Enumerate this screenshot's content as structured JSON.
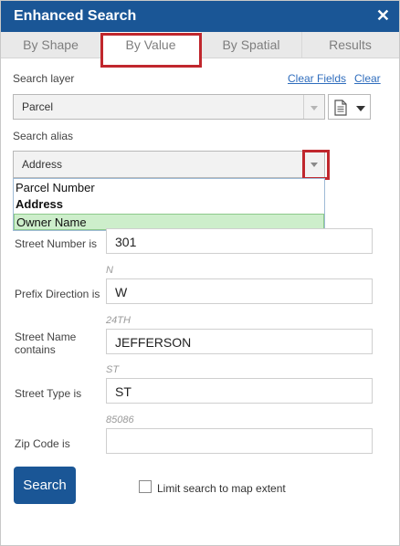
{
  "window": {
    "title": "Enhanced Search",
    "close_glyph": "✕"
  },
  "tabs": [
    {
      "label": "By Shape"
    },
    {
      "label": "By Value"
    },
    {
      "label": "By Spatial"
    },
    {
      "label": "Results"
    }
  ],
  "search_layer": {
    "label": "Search layer",
    "clear_fields": "Clear Fields",
    "clear": "Clear",
    "value": "Parcel"
  },
  "search_alias": {
    "label": "Search alias",
    "value": "Address",
    "options": [
      "Parcel Number",
      "Address",
      "Owner Name"
    ]
  },
  "fields": {
    "street_number": {
      "label": "Street Number is",
      "value": "301"
    },
    "prefix_direction": {
      "label": "Prefix Direction is",
      "hint": "N",
      "value": "W"
    },
    "street_name": {
      "label": "Street Name contains",
      "hint": "24TH",
      "value": "JEFFERSON"
    },
    "street_type": {
      "label": "Street Type is",
      "hint": "ST",
      "value": "ST"
    },
    "zip_code": {
      "label": "Zip Code is",
      "hint": "85086",
      "value": ""
    }
  },
  "search_button": "Search",
  "limit_checkbox": {
    "label": "Limit search to map extent",
    "checked": false
  },
  "colors": {
    "header": "#1a5696",
    "highlight": "#c0272d",
    "selected_option": "#cdeecb",
    "link": "#2f6dbd"
  },
  "icons": {
    "close": "close-icon",
    "dropdown": "chevron-down-icon",
    "document": "document-icon"
  }
}
